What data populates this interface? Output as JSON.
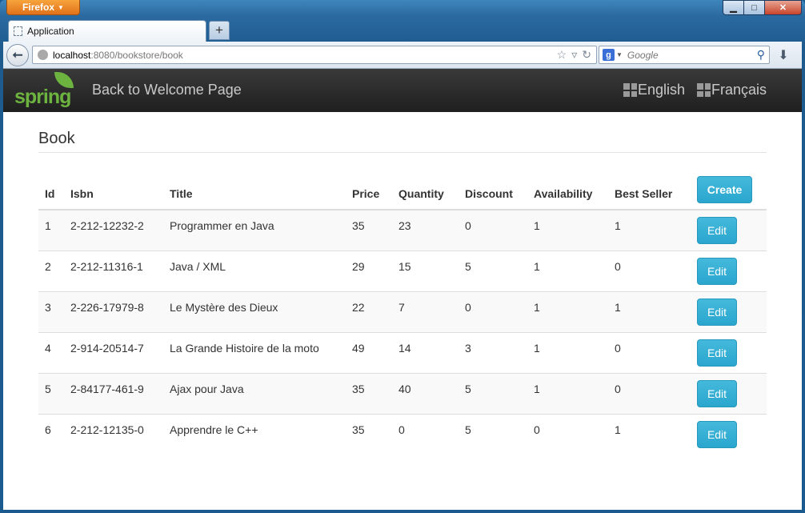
{
  "browser": {
    "app_button": "Firefox",
    "tab_title": "Application",
    "url_host": "localhost",
    "url_rest": ":8080/bookstore/book",
    "search_engine": "Google",
    "search_placeholder": "Google"
  },
  "app": {
    "logo_text": "spring",
    "back_link": "Back to Welcome Page",
    "languages": [
      "English",
      "Français"
    ]
  },
  "page": {
    "title": "Book",
    "create_label": "Create",
    "edit_label": "Edit",
    "columns": [
      "Id",
      "Isbn",
      "Title",
      "Price",
      "Quantity",
      "Discount",
      "Availability",
      "Best Seller"
    ],
    "rows": [
      [
        "1",
        "2-212-12232-2",
        "Programmer en Java",
        "35",
        "23",
        "0",
        "1",
        "1"
      ],
      [
        "2",
        "2-212-11316-1",
        "Java / XML",
        "29",
        "15",
        "5",
        "1",
        "0"
      ],
      [
        "3",
        "2-226-17979-8",
        "Le Mystère des Dieux",
        "22",
        "7",
        "0",
        "1",
        "1"
      ],
      [
        "4",
        "2-914-20514-7",
        "La Grande Histoire de la moto",
        "49",
        "14",
        "3",
        "1",
        "0"
      ],
      [
        "5",
        "2-84177-461-9",
        "Ajax pour Java",
        "35",
        "40",
        "5",
        "1",
        "0"
      ],
      [
        "6",
        "2-212-12135-0",
        "Apprendre le C++",
        "35",
        "0",
        "5",
        "0",
        "1"
      ]
    ]
  },
  "colors": {
    "accent": "#2aa6ce",
    "navbar": "#222222",
    "brand": "#6db33f"
  }
}
